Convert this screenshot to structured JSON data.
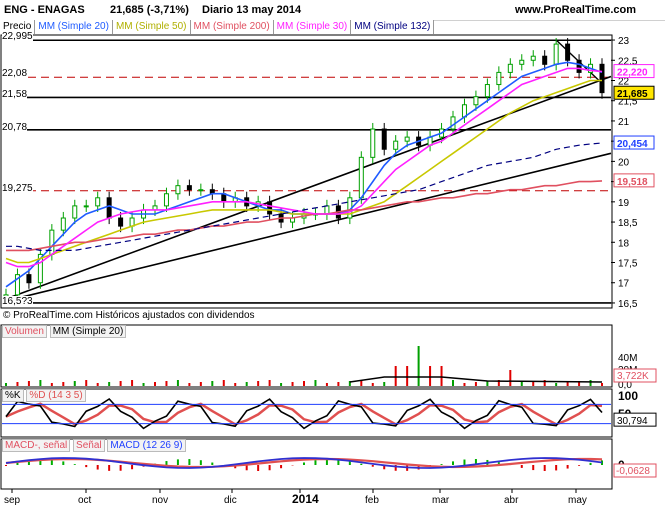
{
  "header": {
    "symbol": "ENG - ENAGAS",
    "price_change": "21,685 (-3,71%)",
    "period_date": "Diario  13 may 2014",
    "site": "www.ProRealTime.com"
  },
  "legend_main": [
    "MM (Simple 20)",
    "MM (Simple 50)",
    "MM (Simple 200)",
    "MM (Simple 30)",
    "MM (Simple 132)"
  ],
  "panel_labels": {
    "price": "Precio",
    "copyright": "© ProRealTime.com  Históricos ajustados con dividendos",
    "volume": "Volumen",
    "volume_ma": "MM (Simple 20)",
    "stoch_k": "%K",
    "stoch_d": "%D (14 3 5)",
    "macd_line": "MACD-, señal",
    "macd_signal": "Señal",
    "macd": "MACD (12 26 9)"
  },
  "levels": {
    "l1": "22,995",
    "l2": "22,08",
    "l3": "21,58",
    "l4": "20,78",
    "l5": "19,275",
    "l6": "16,5?3"
  },
  "price_tags": {
    "ma_pink": "22,220",
    "last": "21,685",
    "ma_blue": "20,454",
    "ma_red": "19,518"
  },
  "axis": {
    "price_ticks": [
      "23",
      "22,5",
      "22",
      "21,5",
      "21",
      "20,5",
      "20",
      "19,5",
      "19",
      "18,5",
      "18",
      "17,5",
      "17",
      "16,5"
    ],
    "volume_ticks": [
      "40M",
      "20M",
      "0,0"
    ],
    "volume_tag": "3,722K",
    "stoch_ticks": [
      "100",
      "50"
    ],
    "stoch_tag": "30,794",
    "macd_ticks": [
      "0",
      "-0,0628"
    ],
    "months": [
      "sep",
      "oct",
      "nov",
      "dic",
      "2014",
      "feb",
      "mar",
      "abr",
      "may"
    ]
  },
  "colors": {
    "ma20": "#1f5bff",
    "ma50": "#c8c800",
    "ma200": "#e05060",
    "ma30": "#ff20ff",
    "ma132": "#000080",
    "up": "#00a000",
    "down": "#000000",
    "stoch_d": "#e05050",
    "macd_hist_pos": "#00b000",
    "macd_hist_neg": "#e00000"
  },
  "chart_data": {
    "type": "line",
    "title": "ENG - ENAGAS",
    "x": [
      "sep",
      "oct",
      "nov",
      "dic",
      "2014",
      "feb",
      "mar",
      "abr",
      "may"
    ],
    "close": [
      16.7,
      17.2,
      17.0,
      17.7,
      18.3,
      18.6,
      18.9,
      18.9,
      19.1,
      18.6,
      18.4,
      18.6,
      18.8,
      18.9,
      19.2,
      19.4,
      19.3,
      19.3,
      19.2,
      19.0,
      19.1,
      18.9,
      19.0,
      18.7,
      18.5,
      18.6,
      18.7,
      18.7,
      18.9,
      18.6,
      19.1,
      20.1,
      20.8,
      20.3,
      20.5,
      20.6,
      20.4,
      20.6,
      20.8,
      21.1,
      21.4,
      21.6,
      21.9,
      22.2,
      22.4,
      22.5,
      22.6,
      22.4,
      22.9,
      22.5,
      22.2,
      22.4,
      21.7
    ],
    "series": [
      {
        "name": "MM (Simple 20)",
        "values": [
          16.9,
          17.1,
          17.3,
          17.6,
          17.9,
          18.2,
          18.5,
          18.7,
          18.8,
          18.9,
          18.8,
          18.7,
          18.7,
          18.7,
          18.8,
          18.9,
          19.0,
          19.1,
          19.2,
          19.2,
          19.1,
          19.0,
          18.9,
          18.8,
          18.8,
          18.7,
          18.7,
          18.7,
          18.7,
          18.7,
          18.8,
          19.1,
          19.5,
          19.9,
          20.2,
          20.4,
          20.5,
          20.6,
          20.7,
          20.9,
          21.1,
          21.3,
          21.5,
          21.7,
          21.9,
          22.1,
          22.2,
          22.3,
          22.4,
          22.45,
          22.4,
          22.3,
          22.2
        ]
      },
      {
        "name": "MM (Simple 50)",
        "values": [
          17.6,
          17.5,
          17.5,
          17.6,
          17.7,
          17.8,
          17.9,
          18.0,
          18.1,
          18.2,
          18.3,
          18.4,
          18.5,
          18.55,
          18.6,
          18.65,
          18.7,
          18.75,
          18.8,
          18.8,
          18.8,
          18.8,
          18.8,
          18.8,
          18.75,
          18.7,
          18.7,
          18.7,
          18.7,
          18.7,
          18.7,
          18.8,
          18.9,
          19.0,
          19.2,
          19.4,
          19.6,
          19.8,
          20.0,
          20.2,
          20.4,
          20.6,
          20.8,
          21.0,
          21.2,
          21.35,
          21.5,
          21.6,
          21.7,
          21.8,
          21.9,
          22.0,
          22.0
        ]
      },
      {
        "name": "MM (Simple 200)",
        "values": [
          17.8,
          17.8,
          17.8,
          17.85,
          17.9,
          17.95,
          18.0,
          18.0,
          18.05,
          18.1,
          18.1,
          18.15,
          18.2,
          18.2,
          18.25,
          18.3,
          18.3,
          18.35,
          18.4,
          18.4,
          18.45,
          18.5,
          18.5,
          18.55,
          18.6,
          18.6,
          18.65,
          18.7,
          18.7,
          18.75,
          18.8,
          18.8,
          18.85,
          18.9,
          18.95,
          19.0,
          19.0,
          19.05,
          19.1,
          19.1,
          19.15,
          19.2,
          19.2,
          19.25,
          19.3,
          19.3,
          19.35,
          19.4,
          19.4,
          19.45,
          19.5,
          19.5,
          19.518
        ]
      },
      {
        "name": "MM (Simple 30)",
        "values": [
          17.5,
          17.4,
          17.4,
          17.5,
          17.7,
          17.9,
          18.1,
          18.3,
          18.5,
          18.6,
          18.7,
          18.75,
          18.8,
          18.8,
          18.8,
          18.85,
          18.9,
          18.95,
          19.0,
          19.0,
          19.0,
          19.0,
          18.95,
          18.9,
          18.85,
          18.8,
          18.75,
          18.7,
          18.7,
          18.7,
          18.75,
          18.9,
          19.2,
          19.5,
          19.8,
          20.0,
          20.2,
          20.4,
          20.5,
          20.7,
          20.9,
          21.1,
          21.3,
          21.5,
          21.7,
          21.9,
          22.0,
          22.1,
          22.2,
          22.3,
          22.3,
          22.25,
          22.22
        ]
      },
      {
        "name": "MM (Simple 132)",
        "values": [
          17.9,
          17.9,
          17.85,
          17.8,
          17.8,
          17.8,
          17.8,
          17.85,
          17.9,
          17.95,
          18.0,
          18.05,
          18.1,
          18.15,
          18.2,
          18.25,
          18.3,
          18.35,
          18.4,
          18.45,
          18.5,
          18.55,
          18.6,
          18.65,
          18.7,
          18.75,
          18.8,
          18.85,
          18.9,
          18.95,
          19.0,
          19.05,
          19.1,
          19.15,
          19.2,
          19.25,
          19.3,
          19.4,
          19.5,
          19.6,
          19.7,
          19.8,
          19.9,
          19.95,
          20.0,
          20.05,
          20.1,
          20.2,
          20.3,
          20.35,
          20.4,
          20.43,
          20.454
        ]
      }
    ],
    "ylim": [
      16.4,
      23.1
    ]
  }
}
